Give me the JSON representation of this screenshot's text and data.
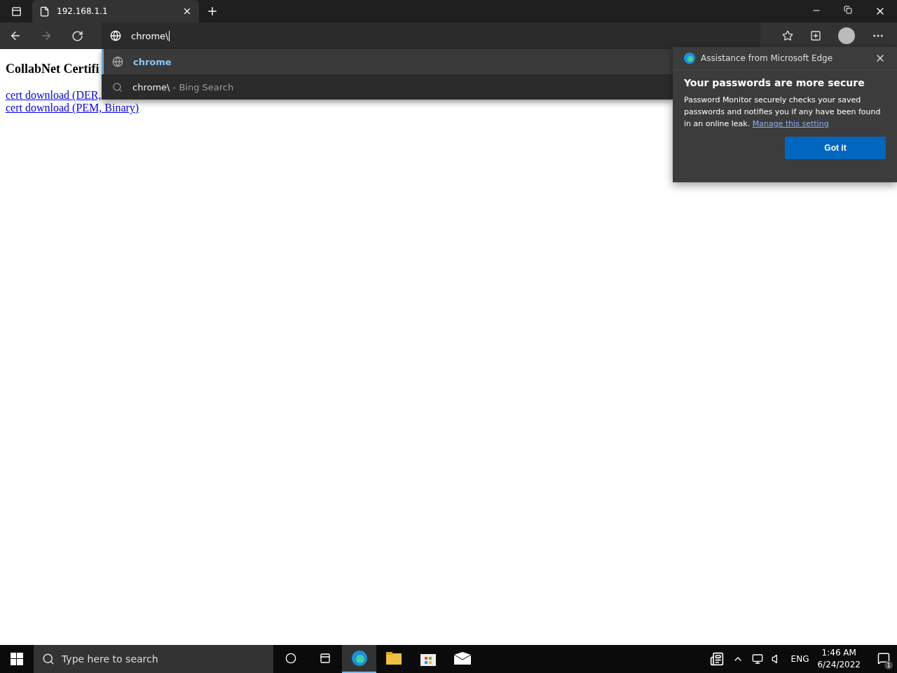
{
  "tab_strip": {
    "tabs": [
      {
        "title": "192.168.1.1",
        "selected": true
      }
    ]
  },
  "address_bar": {
    "value": "chrome\\"
  },
  "suggestions": [
    {
      "kind": "url",
      "text": "chrome",
      "selected": true
    },
    {
      "kind": "search",
      "text": "chrome\\",
      "suffix": " - Bing Search",
      "selected": false
    }
  ],
  "page": {
    "heading": "CollabNet Certifi",
    "links": [
      "cert download (DER,",
      "cert download (PEM, Binary)"
    ]
  },
  "popup": {
    "source": "Assistance from Microsoft Edge",
    "title": "Your passwords are more secure",
    "body": "Password Monitor securely checks your saved passwords and notifies you if any have been found in an online leak.",
    "link": "Manage this setting",
    "button": "Got it"
  },
  "taskbar": {
    "search_placeholder": "Type here to search",
    "apps": [
      {
        "kind": "edge",
        "selected": true
      },
      {
        "kind": "folder",
        "selected": false
      },
      {
        "kind": "store",
        "selected": false
      },
      {
        "kind": "mail",
        "selected": false
      }
    ],
    "language": "ENG",
    "time": "1:46 AM",
    "date": "6/24/2022",
    "notifications": "1"
  }
}
